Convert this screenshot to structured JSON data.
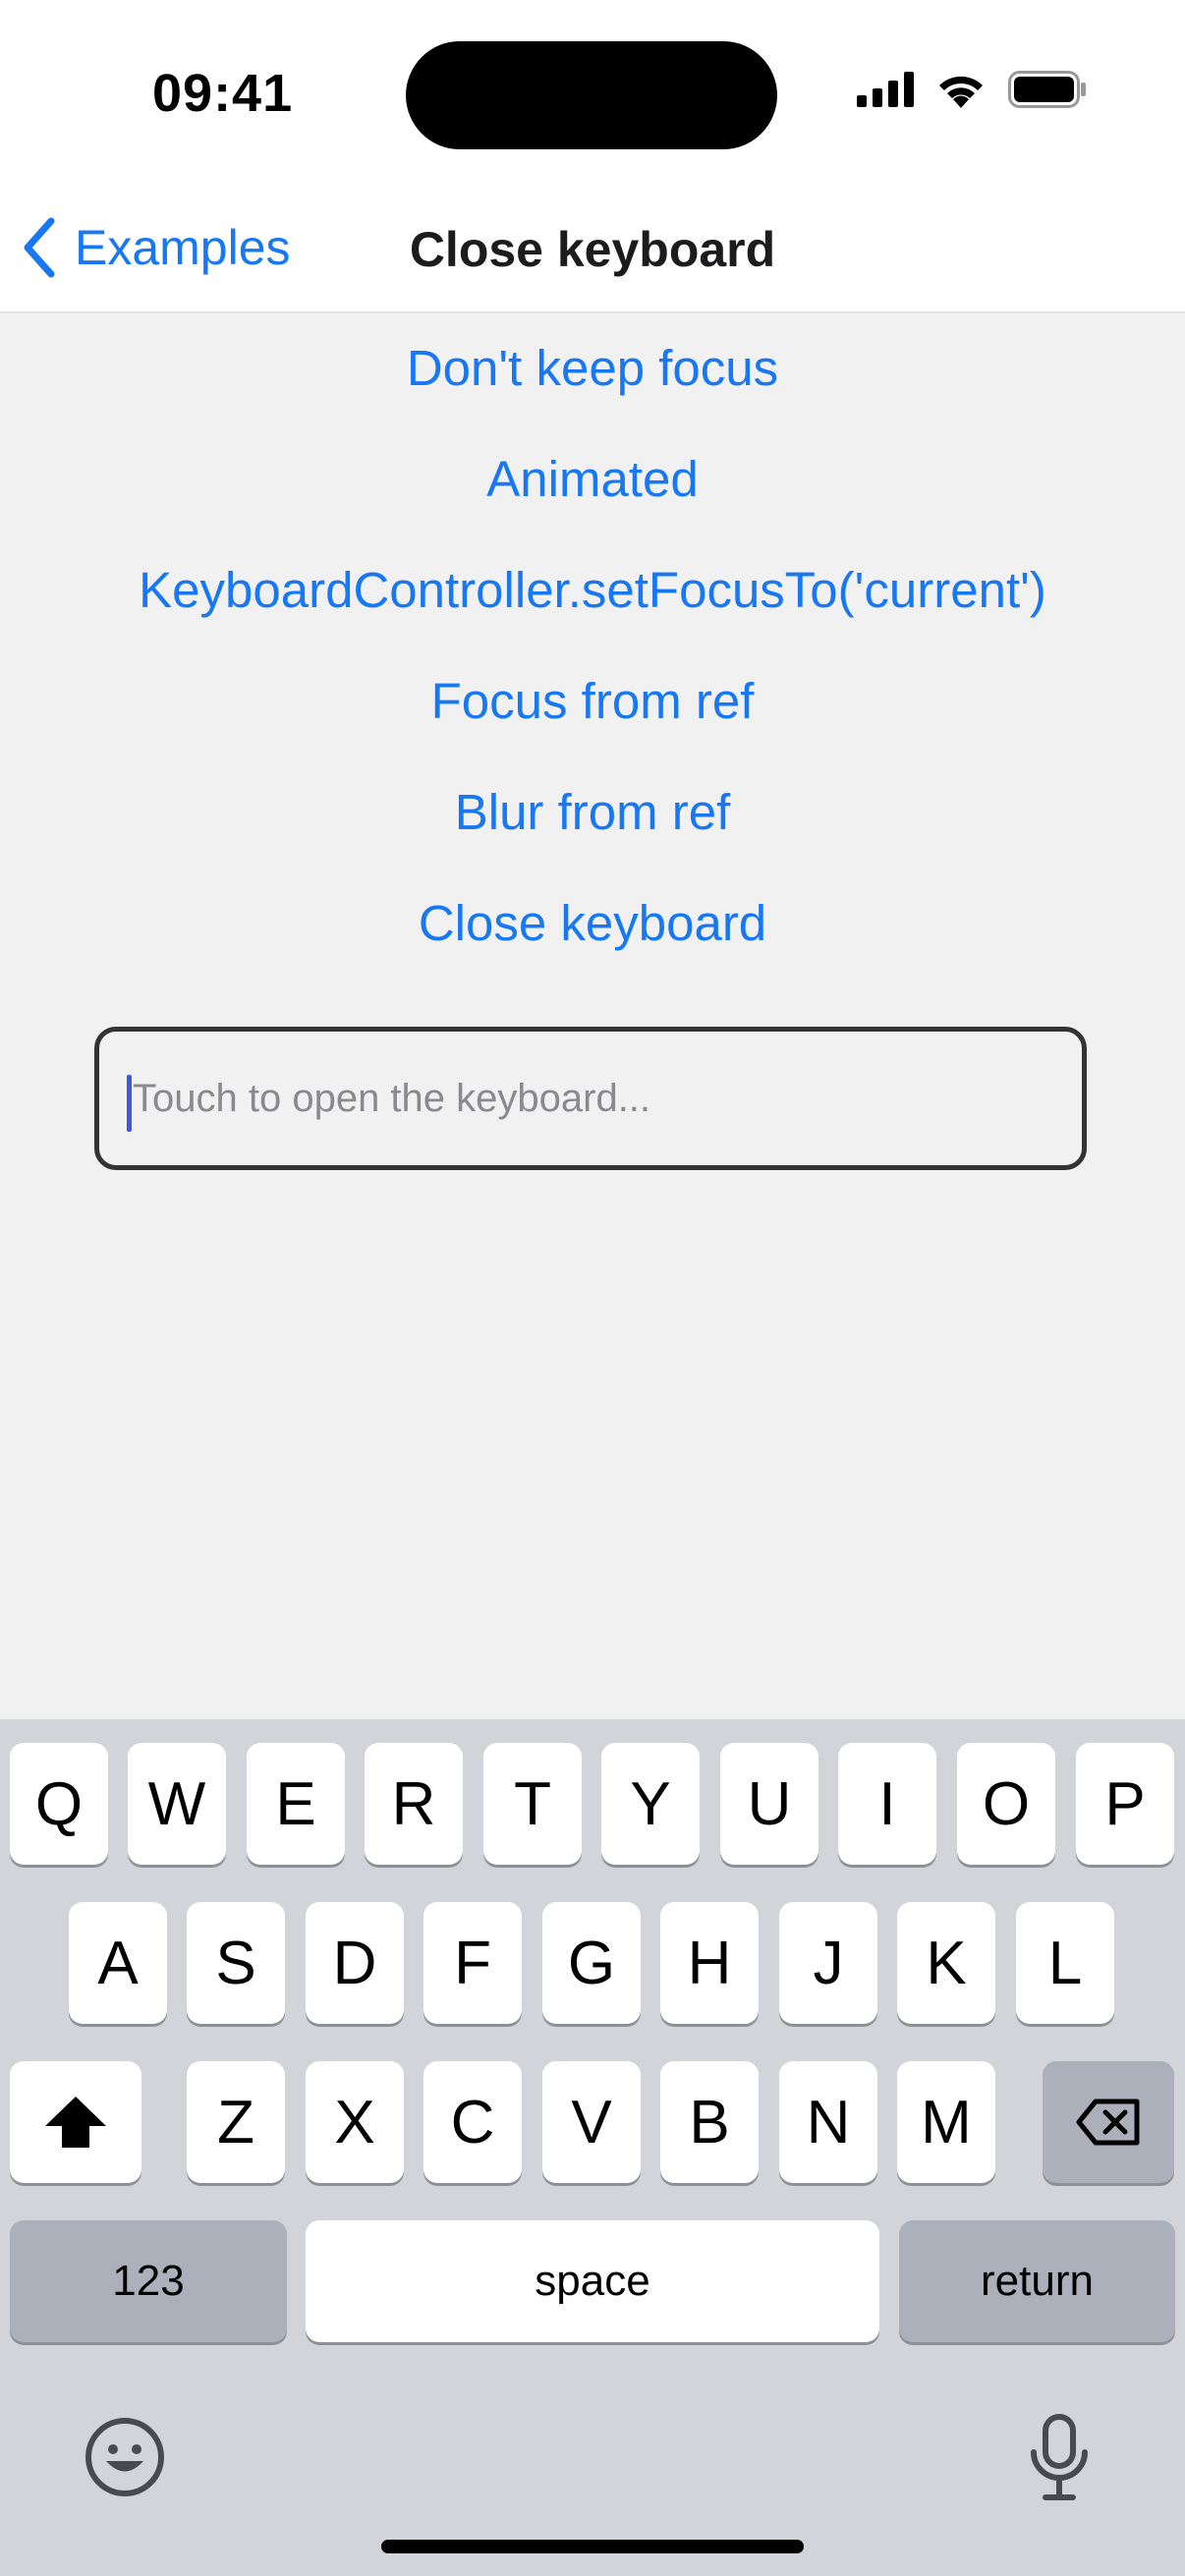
{
  "status": {
    "time": "09:41"
  },
  "nav": {
    "back_label": "Examples",
    "title": "Close keyboard"
  },
  "actions": [
    "Don't keep focus",
    "Animated",
    "KeyboardController.setFocusTo('current')",
    "Focus from ref",
    "Blur from ref",
    "Close keyboard"
  ],
  "input": {
    "placeholder": "Touch to open the keyboard...",
    "value": ""
  },
  "keyboard": {
    "row1": [
      "Q",
      "W",
      "E",
      "R",
      "T",
      "Y",
      "U",
      "I",
      "O",
      "P"
    ],
    "row2": [
      "A",
      "S",
      "D",
      "F",
      "G",
      "H",
      "J",
      "K",
      "L"
    ],
    "row3": [
      "Z",
      "X",
      "C",
      "V",
      "B",
      "N",
      "M"
    ],
    "numbers_label": "123",
    "space_label": "space",
    "return_label": "return",
    "icons": [
      "shift-icon",
      "delete-icon",
      "emoji-icon",
      "microphone-icon"
    ]
  },
  "colors": {
    "accent": "#1877f2",
    "background": "#f1f1f1",
    "keyboard_bg": "#d2d4da"
  }
}
